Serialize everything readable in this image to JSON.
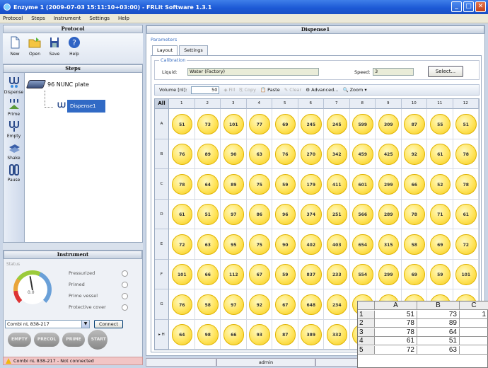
{
  "window": {
    "title": "Enzyme 1 (2009-07-03 15:11:10+03:00) - FRLit Software 1.3.1"
  },
  "menu": [
    "Protocol",
    "Steps",
    "Instrument",
    "Settings",
    "Help"
  ],
  "protocol": {
    "header": "Protocol",
    "toolbar": [
      {
        "label": "New",
        "icon": "new-file-icon"
      },
      {
        "label": "Open",
        "icon": "open-folder-icon"
      },
      {
        "label": "Save",
        "icon": "save-icon"
      },
      {
        "label": "Help",
        "icon": "help-icon"
      }
    ]
  },
  "steps": {
    "header": "Steps",
    "palette": [
      {
        "label": "Dispense",
        "icon": "dispense-icon"
      },
      {
        "label": "Prime",
        "icon": "prime-icon"
      },
      {
        "label": "Empty",
        "icon": "empty-icon"
      },
      {
        "label": "Shake",
        "icon": "shake-icon"
      },
      {
        "label": "Pause",
        "icon": "pause-icon"
      }
    ],
    "tree": {
      "plate": "96 NUNC plate",
      "step": "Dispense1"
    }
  },
  "instrument": {
    "header": "Instrument",
    "status_label": "Status",
    "gauge_value": "0.0",
    "statuses": [
      "Pressurized",
      "Primed",
      "Prime vessel",
      "Protective cover"
    ],
    "device": "Combi nL 838-217",
    "connect_label": "Connect",
    "buttons": [
      "EMPTY",
      "PRECOL",
      "PRIME",
      "START"
    ]
  },
  "statusbar": {
    "left": "Combi nL 838-217 - Not connected",
    "user": "admin"
  },
  "main": {
    "header": "Dispense1",
    "params_label": "Parameters",
    "tabs": [
      "Layout",
      "Settings"
    ],
    "calibration": {
      "label": "Calibration",
      "liquid_label": "Liquid:",
      "liquid_value": "Water (Factory)",
      "speed_label": "Speed:",
      "speed_value": "3",
      "select_label": "Select..."
    },
    "volume": {
      "label": "Volume [nl]:",
      "value": "50",
      "fill": "Fill",
      "copy": "Copy",
      "paste": "Paste",
      "clear": "Clear",
      "advanced": "Advanced...",
      "zoom": "Zoom"
    },
    "plate": {
      "all_label": "All",
      "columns": [
        "1",
        "2",
        "3",
        "4",
        "5",
        "6",
        "7",
        "8",
        "9",
        "10",
        "11",
        "12"
      ],
      "rows": [
        {
          "label": "A",
          "values": [
            "51",
            "73",
            "101",
            "77",
            "69",
            "245",
            "245",
            "599",
            "309",
            "87",
            "55",
            "51"
          ]
        },
        {
          "label": "B",
          "values": [
            "76",
            "89",
            "90",
            "63",
            "76",
            "270",
            "342",
            "459",
            "425",
            "92",
            "61",
            "78"
          ]
        },
        {
          "label": "C",
          "values": [
            "78",
            "64",
            "89",
            "75",
            "59",
            "179",
            "411",
            "601",
            "299",
            "66",
            "52",
            "78"
          ]
        },
        {
          "label": "D",
          "values": [
            "61",
            "51",
            "97",
            "86",
            "96",
            "374",
            "251",
            "566",
            "289",
            "78",
            "71",
            "61"
          ]
        },
        {
          "label": "E",
          "values": [
            "72",
            "63",
            "95",
            "75",
            "90",
            "402",
            "403",
            "654",
            "315",
            "58",
            "69",
            "72"
          ]
        },
        {
          "label": "F",
          "values": [
            "101",
            "66",
            "112",
            "67",
            "59",
            "837",
            "233",
            "554",
            "299",
            "69",
            "59",
            "101"
          ]
        },
        {
          "label": "G",
          "values": [
            "76",
            "58",
            "97",
            "92",
            "67",
            "648",
            "234",
            "",
            "",
            "",
            "",
            ""
          ]
        },
        {
          "label": "H",
          "values": [
            "64",
            "98",
            "66",
            "93",
            "87",
            "389",
            "332",
            "",
            "",
            "",
            "",
            ""
          ]
        }
      ]
    }
  },
  "spreadsheet": {
    "columns": [
      "A",
      "B",
      "C"
    ],
    "rows": [
      [
        "1",
        "51",
        "73",
        "1"
      ],
      [
        "2",
        "78",
        "89",
        ""
      ],
      [
        "3",
        "78",
        "64",
        ""
      ],
      [
        "4",
        "61",
        "51",
        ""
      ],
      [
        "5",
        "72",
        "63",
        ""
      ]
    ]
  }
}
